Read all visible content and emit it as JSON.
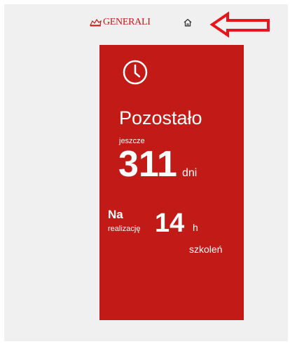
{
  "header": {
    "logo_text": "GENERALI",
    "logo_icon": "generali-lion-icon",
    "home_icon": "home-icon",
    "arrow_icon": "arrow-left-icon"
  },
  "card": {
    "clock_icon": "clock-icon",
    "title": "Pozostało",
    "prefix": "jeszcze",
    "days_value": "311",
    "days_unit": "dni",
    "na_label": "Na",
    "realizacje_label": "realizację",
    "hours_value": "14",
    "hours_unit": "h",
    "szkolen_label": "szkoleń"
  },
  "colors": {
    "brand_red": "#c21b17",
    "background": "#f0f0f0",
    "text_on_card": "#ffffff"
  }
}
